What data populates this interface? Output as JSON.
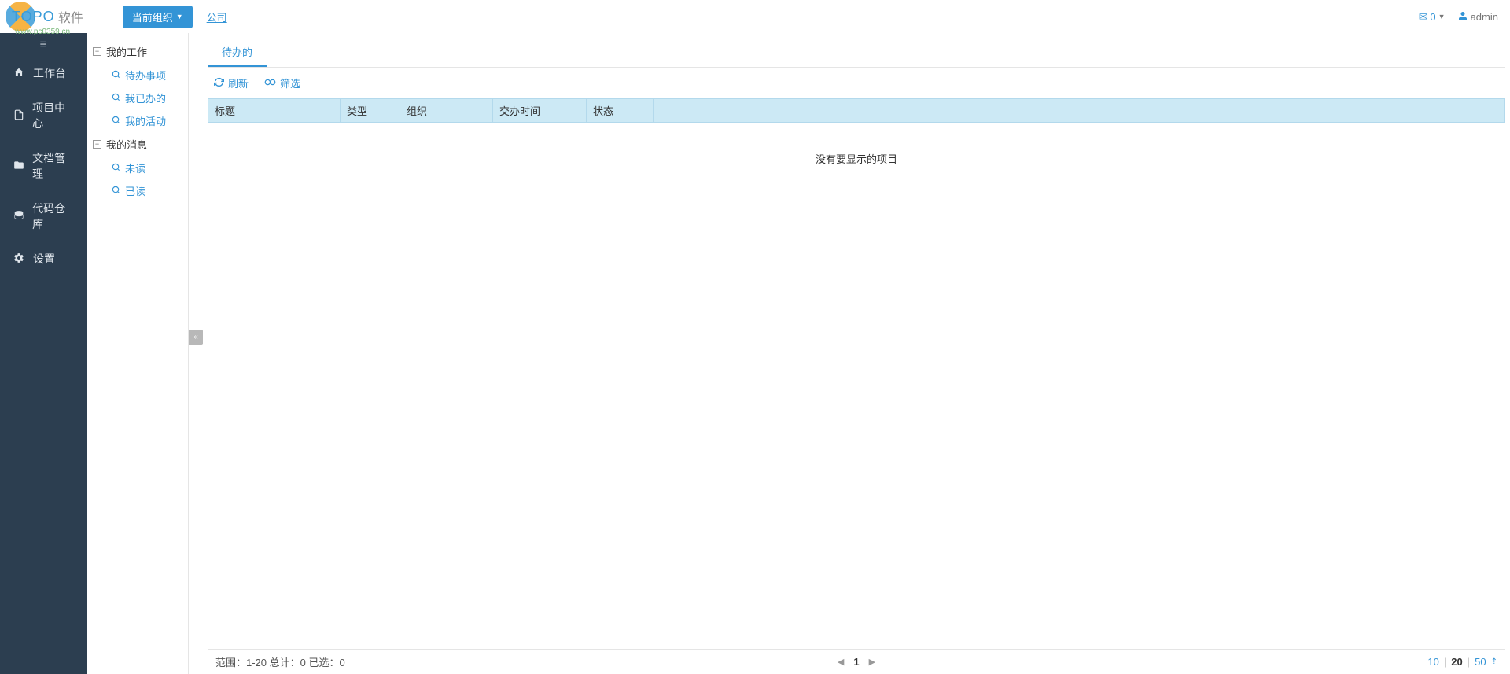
{
  "header": {
    "logo_text": "TOPO",
    "logo_suffix": "软件",
    "watermark": "www.pc0359.cn",
    "org_dropdown_label": "当前组织",
    "company_link": "公司",
    "mail_count": "0",
    "username": "admin"
  },
  "sidebar": {
    "items": [
      {
        "icon": "home",
        "label": "工作台"
      },
      {
        "icon": "file",
        "label": "项目中心"
      },
      {
        "icon": "folder",
        "label": "文档管理"
      },
      {
        "icon": "database",
        "label": "代码仓库"
      },
      {
        "icon": "gear",
        "label": "设置"
      }
    ]
  },
  "tree": {
    "groups": [
      {
        "label": "我的工作",
        "items": [
          {
            "label": "待办事项"
          },
          {
            "label": "我已办的"
          },
          {
            "label": "我的活动"
          }
        ]
      },
      {
        "label": "我的消息",
        "items": [
          {
            "label": "未读"
          },
          {
            "label": "已读"
          }
        ]
      }
    ]
  },
  "main": {
    "tabs": [
      {
        "label": "待办的",
        "active": true
      }
    ],
    "toolbar": {
      "refresh_label": "刷新",
      "filter_label": "筛选"
    },
    "table": {
      "columns": {
        "title": "标题",
        "type": "类型",
        "org": "组织",
        "time": "交办时间",
        "status": "状态"
      },
      "empty_message": "没有要显示的项目"
    },
    "footer": {
      "range_info": "范围：1-20 总计：0 已选：0",
      "current_page": "1",
      "page_sizes": [
        "10",
        "20",
        "50"
      ],
      "active_size": "20"
    }
  }
}
